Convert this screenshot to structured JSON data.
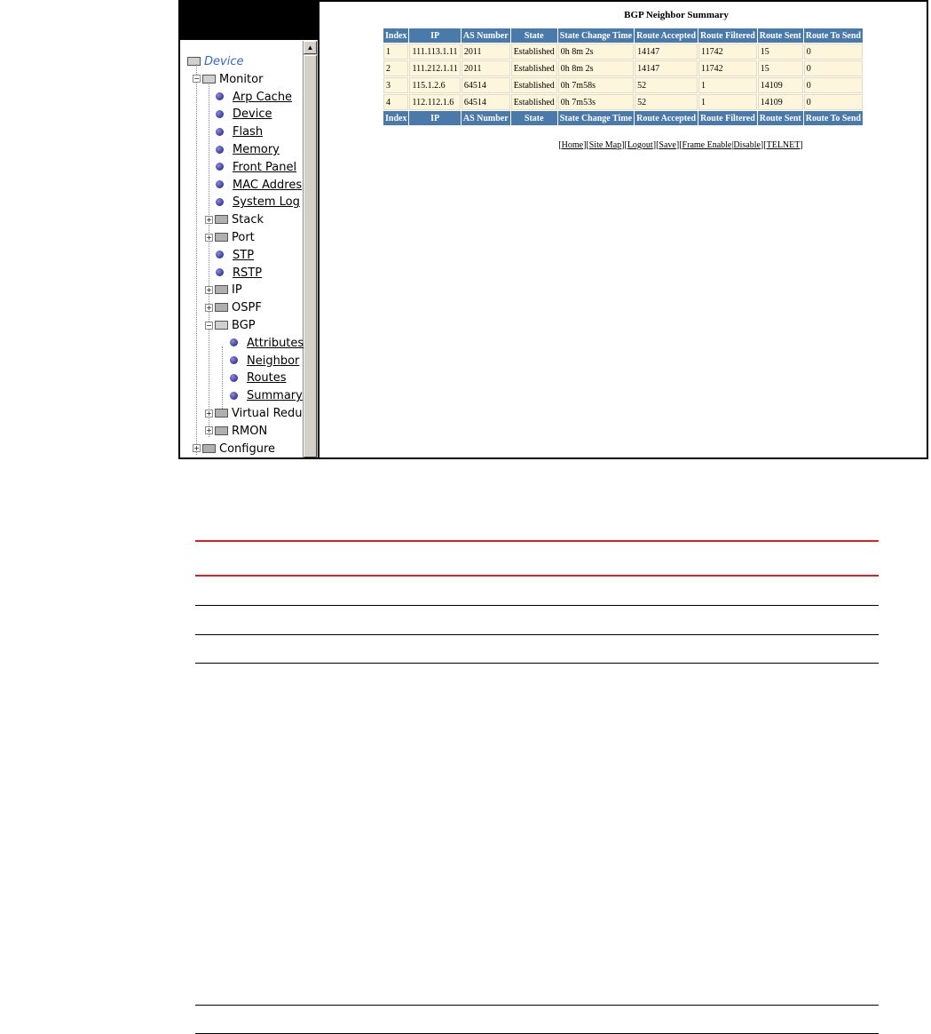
{
  "tree": {
    "root": "Device",
    "items": [
      {
        "label": "Monitor",
        "kind": "folder-open",
        "level": 1
      },
      {
        "label": "Arp Cache",
        "kind": "leaf",
        "level": 2
      },
      {
        "label": "Device",
        "kind": "leaf",
        "level": 2
      },
      {
        "label": "Flash",
        "kind": "leaf",
        "level": 2
      },
      {
        "label": "Memory",
        "kind": "leaf",
        "level": 2
      },
      {
        "label": "Front Panel",
        "kind": "leaf",
        "level": 2
      },
      {
        "label": "MAC Addres",
        "kind": "leaf",
        "level": 2
      },
      {
        "label": "System Log",
        "kind": "leaf",
        "level": 2
      },
      {
        "label": "Stack",
        "kind": "folder",
        "level": 2
      },
      {
        "label": "Port",
        "kind": "folder",
        "level": 2
      },
      {
        "label": "STP",
        "kind": "leaf",
        "level": 2
      },
      {
        "label": "RSTP",
        "kind": "leaf",
        "level": 2
      },
      {
        "label": "IP",
        "kind": "folder",
        "level": 2
      },
      {
        "label": "OSPF",
        "kind": "folder",
        "level": 2
      },
      {
        "label": "BGP",
        "kind": "folder-open",
        "level": 2
      },
      {
        "label": "Attributes",
        "kind": "leaf",
        "level": 3
      },
      {
        "label": "Neighbor",
        "kind": "leaf",
        "level": 3
      },
      {
        "label": "Routes",
        "kind": "leaf",
        "level": 3
      },
      {
        "label": "Summary",
        "kind": "leaf",
        "level": 3
      },
      {
        "label": "Virtual Redu",
        "kind": "folder",
        "level": 2
      },
      {
        "label": "RMON",
        "kind": "folder",
        "level": 2
      },
      {
        "label": "Configure",
        "kind": "folder",
        "level": 1
      }
    ]
  },
  "summary": {
    "title": "BGP Neighbor Summary",
    "headers": [
      "Index",
      "IP",
      "AS Number",
      "State",
      "State Change Time",
      "Route Accepted",
      "Route Filtered",
      "Route Sent",
      "Route To Send"
    ],
    "rows": [
      [
        "1",
        "111.113.1.11",
        "2011",
        "Established",
        "0h 8m 2s",
        "14147",
        "11742",
        "15",
        "0"
      ],
      [
        "2",
        "111.212.1.11",
        "2011",
        "Established",
        "0h 8m 2s",
        "14147",
        "11742",
        "15",
        "0"
      ],
      [
        "3",
        "115.1.2.6",
        "64514",
        "Established",
        "0h 7m58s",
        "52",
        "1",
        "14109",
        "0"
      ],
      [
        "4",
        "112.112.1.6",
        "64514",
        "Established",
        "0h 7m53s",
        "52",
        "1",
        "14109",
        "0"
      ]
    ]
  },
  "footer_links": [
    "Home",
    "Site Map",
    "Logout",
    "Save",
    "Frame Enable",
    "Disable",
    "TELNET"
  ],
  "colors": {
    "header_bg": "#4a7aaa",
    "cell_bg": "#fdf6dc",
    "rule_red": "#e02020"
  }
}
